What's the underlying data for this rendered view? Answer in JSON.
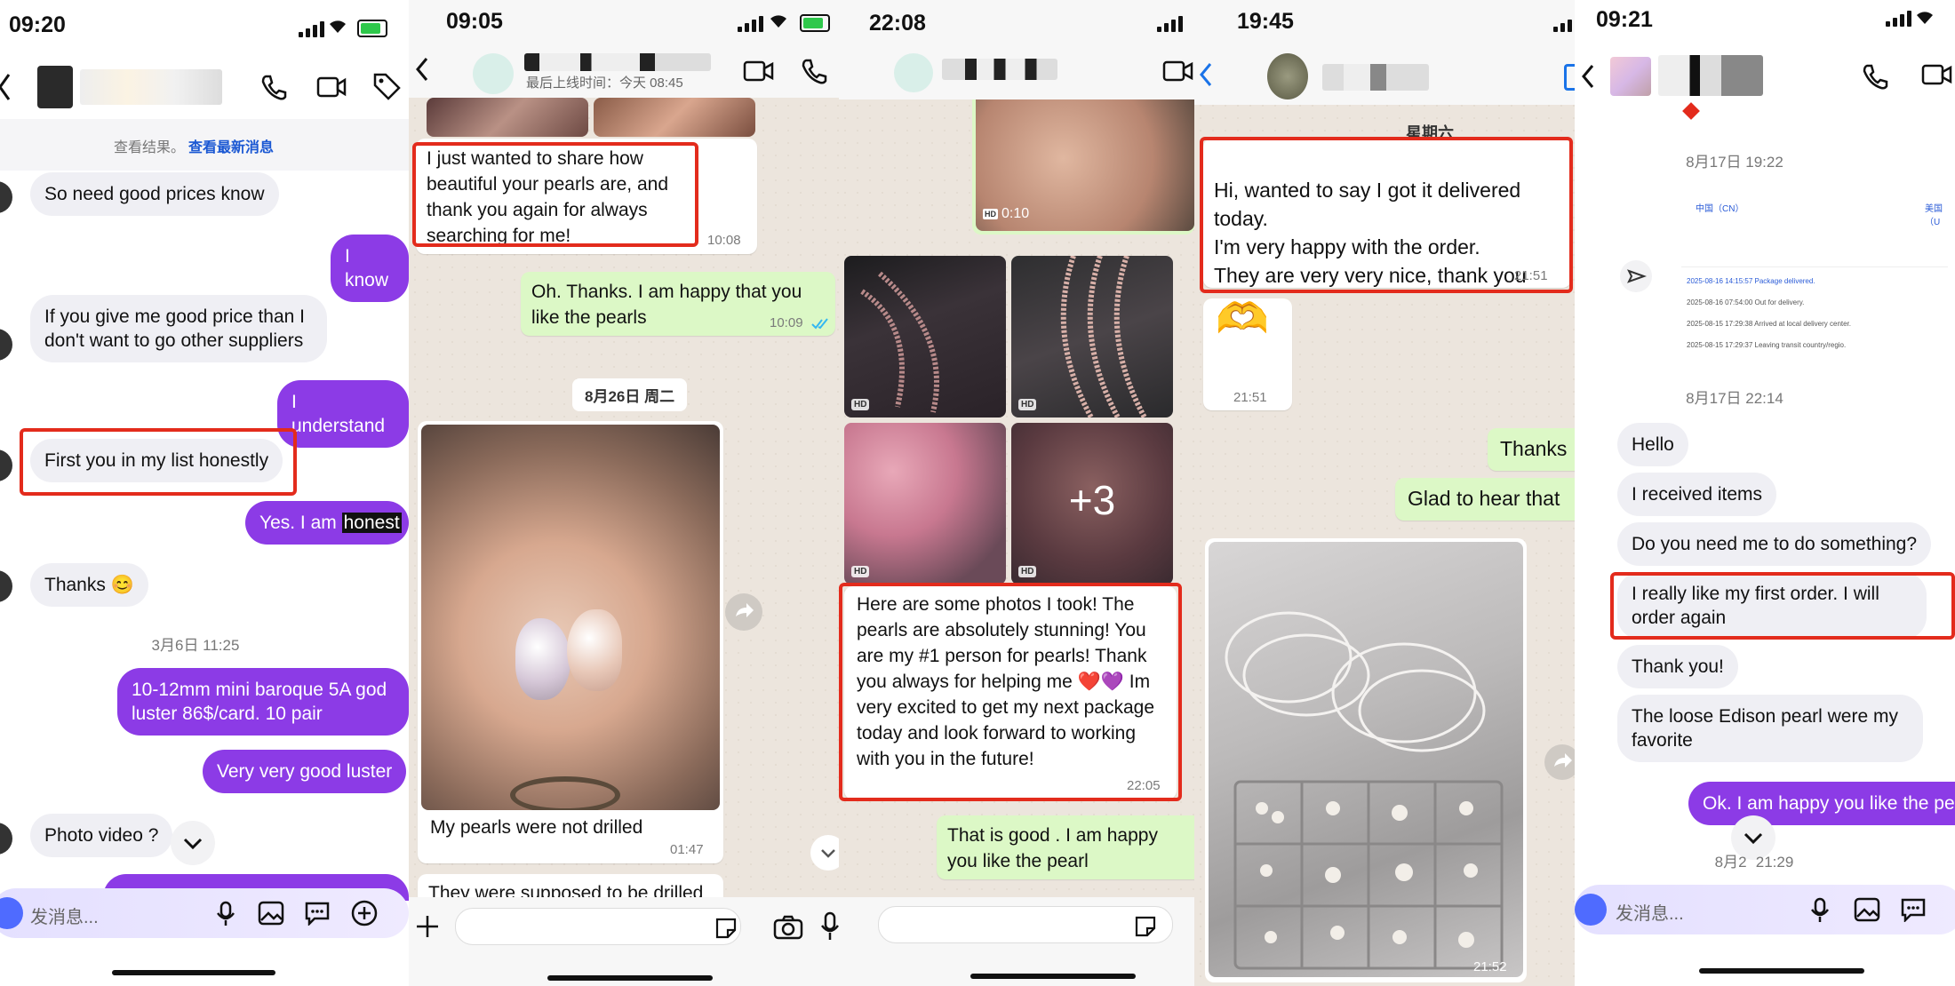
{
  "panel1": {
    "status_time": "09:20",
    "notice_text": "查看结果。",
    "notice_link": "查看最新消息",
    "messages": [
      {
        "dir": "in",
        "text": "So need good prices know"
      },
      {
        "dir": "out",
        "text": "I know"
      },
      {
        "dir": "in",
        "text": "If you give me good price than I don't want to go other suppliers"
      },
      {
        "dir": "out",
        "text": "I understand"
      },
      {
        "dir": "in",
        "text": "First you in my list honestly"
      },
      {
        "dir": "out",
        "text": "Yes. I am",
        "highlight": "honest"
      },
      {
        "dir": "in",
        "text": "Thanks 😊"
      },
      {
        "dir": "out",
        "text": "10-12mm mini baroque 5A god luster 86$/card. 10 pair"
      },
      {
        "dir": "out",
        "text": "Very very good luster"
      },
      {
        "dir": "in",
        "text": "Photo video ?"
      }
    ],
    "date_stamp": "3月6日 11:25",
    "input_placeholder": "发消息..."
  },
  "panel2": {
    "status_time": "09:05",
    "last_seen": "最后上线时间：今天 08:45",
    "msg1": "I just wanted to share how beautiful your pearls are, and thank you again for always searching for me!",
    "msg1_time": "10:08",
    "msg2": "Oh. Thanks. I am happy that you like the pearls",
    "msg2_time": "10:09",
    "date_chip": "8月26日 周二",
    "caption": "My pearls were not drilled",
    "caption_time": "01:47",
    "msg4": "They were supposed to be drilled"
  },
  "panel3": {
    "status_time": "22:08",
    "video_duration": "0:10",
    "more_count": "+3",
    "hd_label": "HD",
    "msg1": "Here are some photos I took! The pearls are absolutely stunning! You are my #1 person for pearls! Thank you always for helping me ❤️💜 Im very excited to get my next package today and look forward to working with you in the future!",
    "msg1_time": "22:05",
    "msg2": "That is good . I am happy you like the pearl"
  },
  "panel4": {
    "status_time": "19:45",
    "day_label": "星期六",
    "msg1": "Hi, wanted to say I got it delivered today.\nI'm very happy with the order.\nThey are very very nice, thank you",
    "msg1_time": "21:51",
    "emoji_msg": "🫶",
    "emoji_time": "21:51",
    "out1": "Thanks",
    "out2": "Glad to hear that",
    "photo_time": "21:52"
  },
  "panel5": {
    "status_time": "09:21",
    "date1": "8月17日 19:22",
    "date2": "8月17日 22:14",
    "tracking": {
      "origin": "中国（CN）",
      "dest": "美国（U",
      "rows": [
        "2025-08-16 14:15:57  Package delivered.",
        "2025-08-16 07:54:00  Out for delivery.",
        "2025-08-15 17:29:38  Arrived at local delivery center.",
        "2025-08-15 17:29:37  Leaving transit country/regio."
      ]
    },
    "messages": [
      {
        "text": "Hello"
      },
      {
        "text": "I received items"
      },
      {
        "text": "Do you need me to do something?"
      },
      {
        "text": "I really like my first order. I will order again"
      },
      {
        "text": "Thank you!"
      },
      {
        "text": "The loose Edison pearl were my favorite"
      }
    ],
    "out1": "Ok. I am happy you like the pe",
    "date3": "8月2   21:29",
    "input_placeholder": "发消息..."
  },
  "colors": {
    "instagram_purple": "#8c3be6",
    "whatsapp_green": "#dcf8c6",
    "highlight_red": "#e32b1c",
    "tick_blue": "#34b7f1"
  }
}
